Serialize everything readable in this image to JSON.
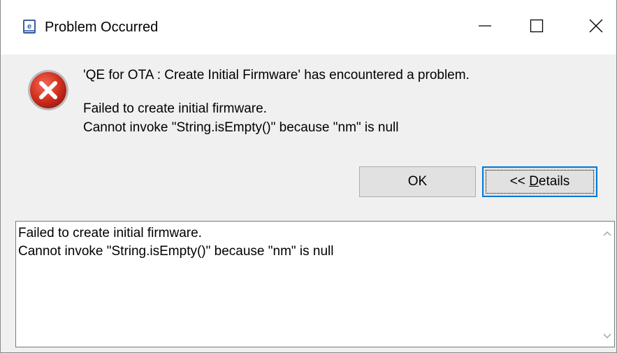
{
  "window": {
    "title": "Problem Occurred",
    "app_icon": "eclipse-e2-studio-icon",
    "controls": {
      "minimize": "minimize-icon",
      "maximize": "maximize-icon",
      "close": "close-icon"
    }
  },
  "message": {
    "icon": "error-icon",
    "title": "'QE for OTA : Create Initial Firmware' has encountered a problem.",
    "line1": "Failed to create initial firmware.",
    "line2": "Cannot invoke \"String.isEmpty()\" because \"nm\" is null"
  },
  "buttons": {
    "ok_label": "OK",
    "details_prefix": "<< ",
    "details_mnemonic": "D",
    "details_rest": "etails"
  },
  "details": {
    "text": "Failed to create initial firmware.\nCannot invoke \"String.isEmpty()\" because \"nm\" is null"
  },
  "colors": {
    "error_red": "#c42b1c",
    "focus_blue": "#0078d7",
    "dialog_bg": "#f0f0f0"
  }
}
